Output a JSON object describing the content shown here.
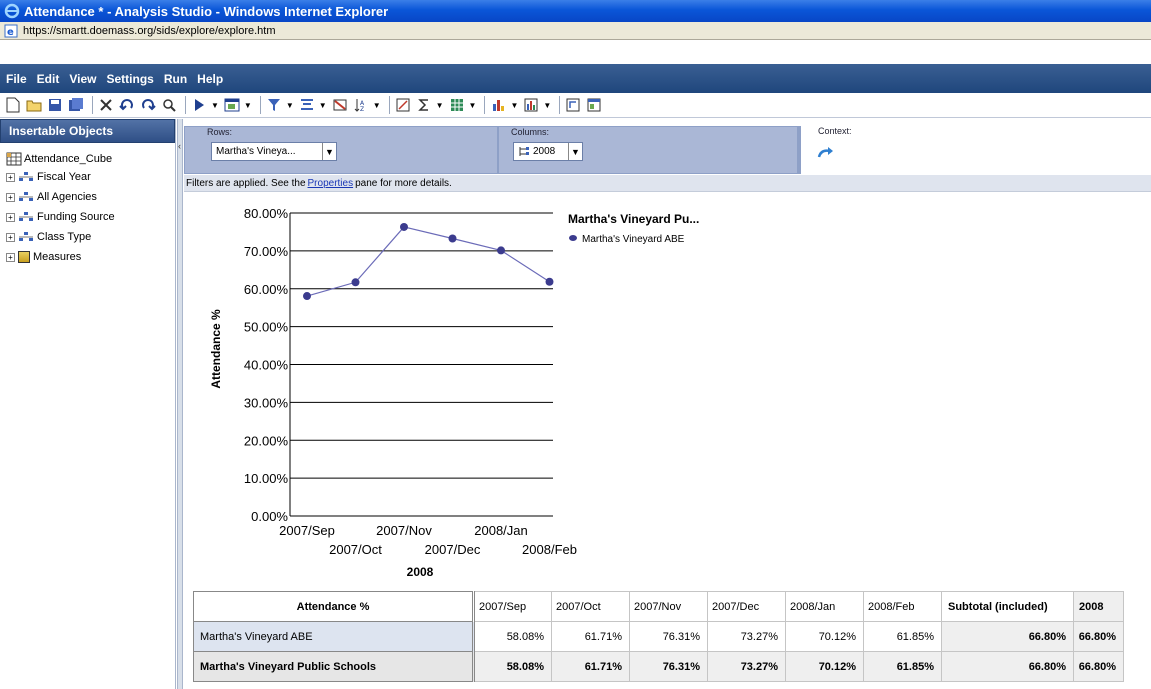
{
  "window": {
    "title": "Attendance * - Analysis Studio - Windows Internet Explorer",
    "url": "https://smartt.doemass.org/sids/explore/explore.htm"
  },
  "menu": [
    "File",
    "Edit",
    "View",
    "Settings",
    "Run",
    "Help"
  ],
  "left_pane": {
    "header": "Insertable Objects",
    "root": "Attendance_Cube",
    "items": [
      "Fiscal Year",
      "All Agencies",
      "Funding Source",
      "Class Type",
      "Measures"
    ]
  },
  "dropzones": {
    "rows_label": "Rows:",
    "rows_value": "Martha's Vineya...",
    "columns_label": "Columns:",
    "columns_value": "2008",
    "context_label": "Context:"
  },
  "filter_bar": {
    "prefix": "Filters are applied. See the",
    "link": "Properties",
    "suffix": "pane for more details."
  },
  "colors": {
    "series": "#3b3b8e",
    "titlebar": "#0a56d8",
    "menubar": "#1f467c"
  },
  "chart_data": {
    "type": "line",
    "title": "Martha's Vineyard Pu...",
    "ylabel": "Attendance %",
    "xlabel": "2008",
    "ylim": [
      0,
      80
    ],
    "yticks": [
      "0.00%",
      "10.00%",
      "20.00%",
      "30.00%",
      "40.00%",
      "50.00%",
      "60.00%",
      "70.00%",
      "80.00%"
    ],
    "categories": [
      "2007/Sep",
      "2007/Oct",
      "2007/Nov",
      "2007/Dec",
      "2008/Jan",
      "2008/Feb"
    ],
    "series": [
      {
        "name": "Martha's Vineyard ABE",
        "values": [
          58.08,
          61.71,
          76.31,
          73.27,
          70.12,
          61.85
        ]
      }
    ],
    "grid": true,
    "legend": "top-right"
  },
  "table": {
    "corner": "Attendance %",
    "columns": [
      "2007/Sep",
      "2007/Oct",
      "2007/Nov",
      "2007/Dec",
      "2008/Jan",
      "2008/Feb"
    ],
    "subtotal_header": "Subtotal (included)",
    "year_header": "2008",
    "rows": [
      {
        "label": "Martha's Vineyard ABE",
        "values": [
          "58.08%",
          "61.71%",
          "76.31%",
          "73.27%",
          "70.12%",
          "61.85%"
        ],
        "subtotal": "66.80%",
        "year": "66.80%"
      },
      {
        "label": "Martha's Vineyard Public Schools",
        "values": [
          "58.08%",
          "61.71%",
          "76.31%",
          "73.27%",
          "70.12%",
          "61.85%"
        ],
        "subtotal": "66.80%",
        "year": "66.80%"
      }
    ]
  }
}
